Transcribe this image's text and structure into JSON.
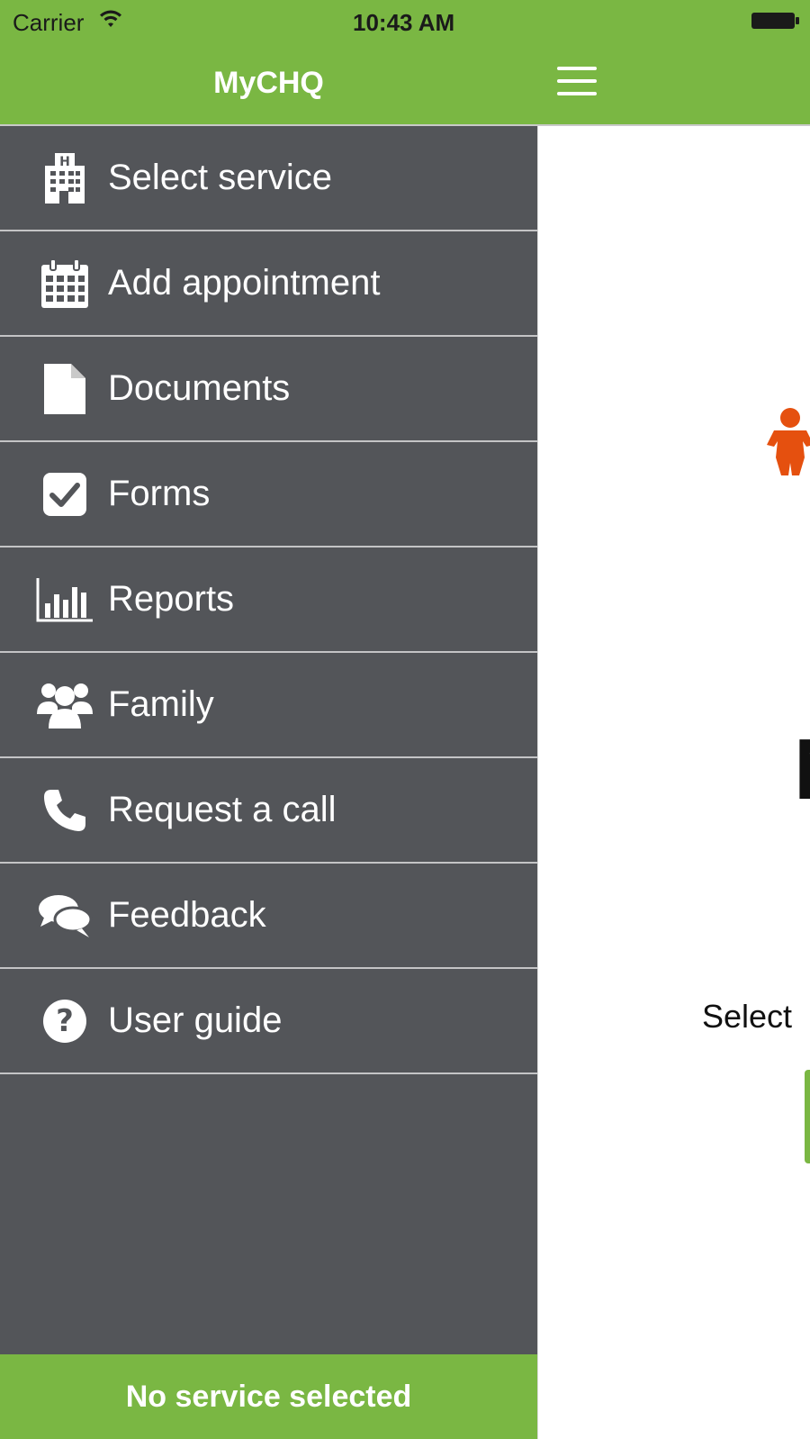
{
  "status_bar": {
    "carrier": "Carrier",
    "time": "10:43 AM"
  },
  "drawer": {
    "title": "MyCHQ",
    "items": [
      {
        "label": "Select service",
        "icon": "hospital-icon"
      },
      {
        "label": "Add appointment",
        "icon": "calendar-icon"
      },
      {
        "label": "Documents",
        "icon": "document-icon"
      },
      {
        "label": "Forms",
        "icon": "checkbox-icon"
      },
      {
        "label": "Reports",
        "icon": "bar-chart-icon"
      },
      {
        "label": "Family",
        "icon": "group-icon"
      },
      {
        "label": "Request a call",
        "icon": "phone-icon"
      },
      {
        "label": "Feedback",
        "icon": "chat-bubbles-icon"
      },
      {
        "label": "User guide",
        "icon": "question-icon"
      }
    ],
    "footer": "No service selected"
  },
  "main": {
    "partial_heading": "N",
    "partial_select_text": "Select"
  },
  "colors": {
    "accent": "#7ab743",
    "drawer_bg": "#535559",
    "mascot": "#e5500f"
  }
}
